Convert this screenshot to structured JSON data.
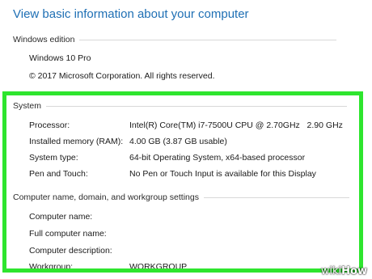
{
  "page": {
    "title": "View basic information about your computer"
  },
  "windows_edition": {
    "header": "Windows edition",
    "edition": "Windows 10 Pro",
    "copyright": "© 2017 Microsoft Corporation. All rights reserved."
  },
  "system": {
    "header": "System",
    "rows": [
      {
        "label": "Processor:",
        "value": "Intel(R) Core(TM) i7-7500U CPU @ 2.70GHz   2.90 GHz"
      },
      {
        "label": "Installed memory (RAM):",
        "value": "4.00 GB (3.87 GB usable)"
      },
      {
        "label": "System type:",
        "value": "64-bit Operating System, x64-based processor"
      },
      {
        "label": "Pen and Touch:",
        "value": "No Pen or Touch Input is available for this Display"
      }
    ]
  },
  "computer_name": {
    "header": "Computer name, domain, and workgroup settings",
    "rows": [
      {
        "label": "Computer name:",
        "value": ""
      },
      {
        "label": "Full computer name:",
        "value": ""
      },
      {
        "label": "Computer description:",
        "value": ""
      },
      {
        "label": "Workgroup:",
        "value": "WORKGROUP"
      }
    ]
  },
  "watermark": {
    "part1": "wiki",
    "part2": "How"
  },
  "colors": {
    "title": "#1e6fb4",
    "highlight": "#2ee52e"
  }
}
